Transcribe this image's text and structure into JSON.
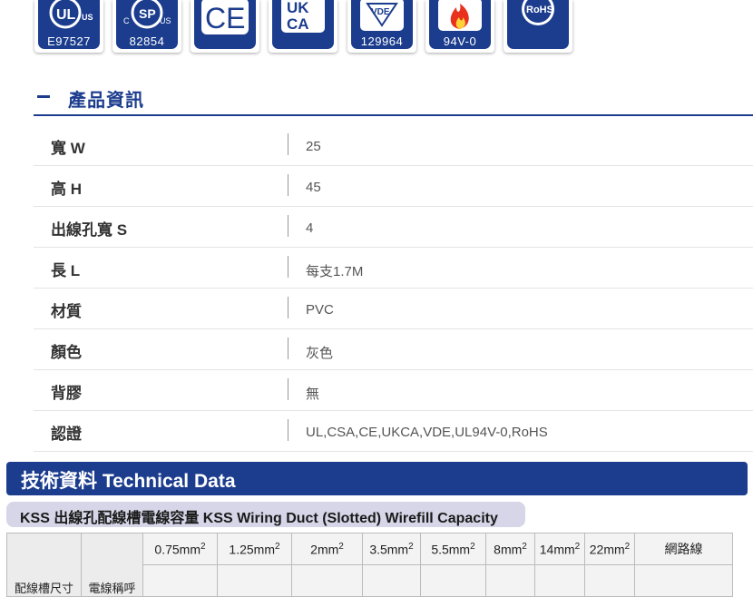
{
  "badges": [
    {
      "name": "ul",
      "mark": "UL",
      "code": "E97527"
    },
    {
      "name": "csa",
      "mark": "SP",
      "code": "82854"
    },
    {
      "name": "ce",
      "mark": "CE",
      "code": ""
    },
    {
      "name": "ukca",
      "mark": "UKCA",
      "code": ""
    },
    {
      "name": "vde",
      "mark": "VDE",
      "code": "129964"
    },
    {
      "name": "flame",
      "mark": "",
      "code": "94V-0"
    },
    {
      "name": "rohs",
      "mark": "RoHS",
      "code": ""
    }
  ],
  "section_title": "產品資訊",
  "specs": [
    {
      "label": "寬 W",
      "value": "25"
    },
    {
      "label": "高 H",
      "value": "45"
    },
    {
      "label": "出線孔寬 S",
      "value": "4"
    },
    {
      "label": "長 L",
      "value": "每支1.7M"
    },
    {
      "label": "材質",
      "value": "PVC"
    },
    {
      "label": "顏色",
      "value": "灰色"
    },
    {
      "label": "背膠",
      "value": "無"
    },
    {
      "label": "認證",
      "value": "UL,CSA,CE,UKCA,VDE,UL94V-0,RoHS"
    }
  ],
  "tech_title": "技術資料 Technical Data",
  "capacity_title": "KSS 出線孔配線槽電線容量  KSS Wiring Duct (Slotted) Wirefill Capacity",
  "capacity_table": {
    "col_size": "配線槽尺寸",
    "col_name": "電線稱呼",
    "wire_sizes": [
      "0.75mm",
      "1.25mm",
      "2mm",
      "3.5mm",
      "5.5mm",
      "8mm",
      "14mm",
      "22mm"
    ],
    "squared": "2",
    "network": "網路線"
  },
  "colors": {
    "brand": "#1c3d8e",
    "sub_banner": "#d6d6e8"
  }
}
